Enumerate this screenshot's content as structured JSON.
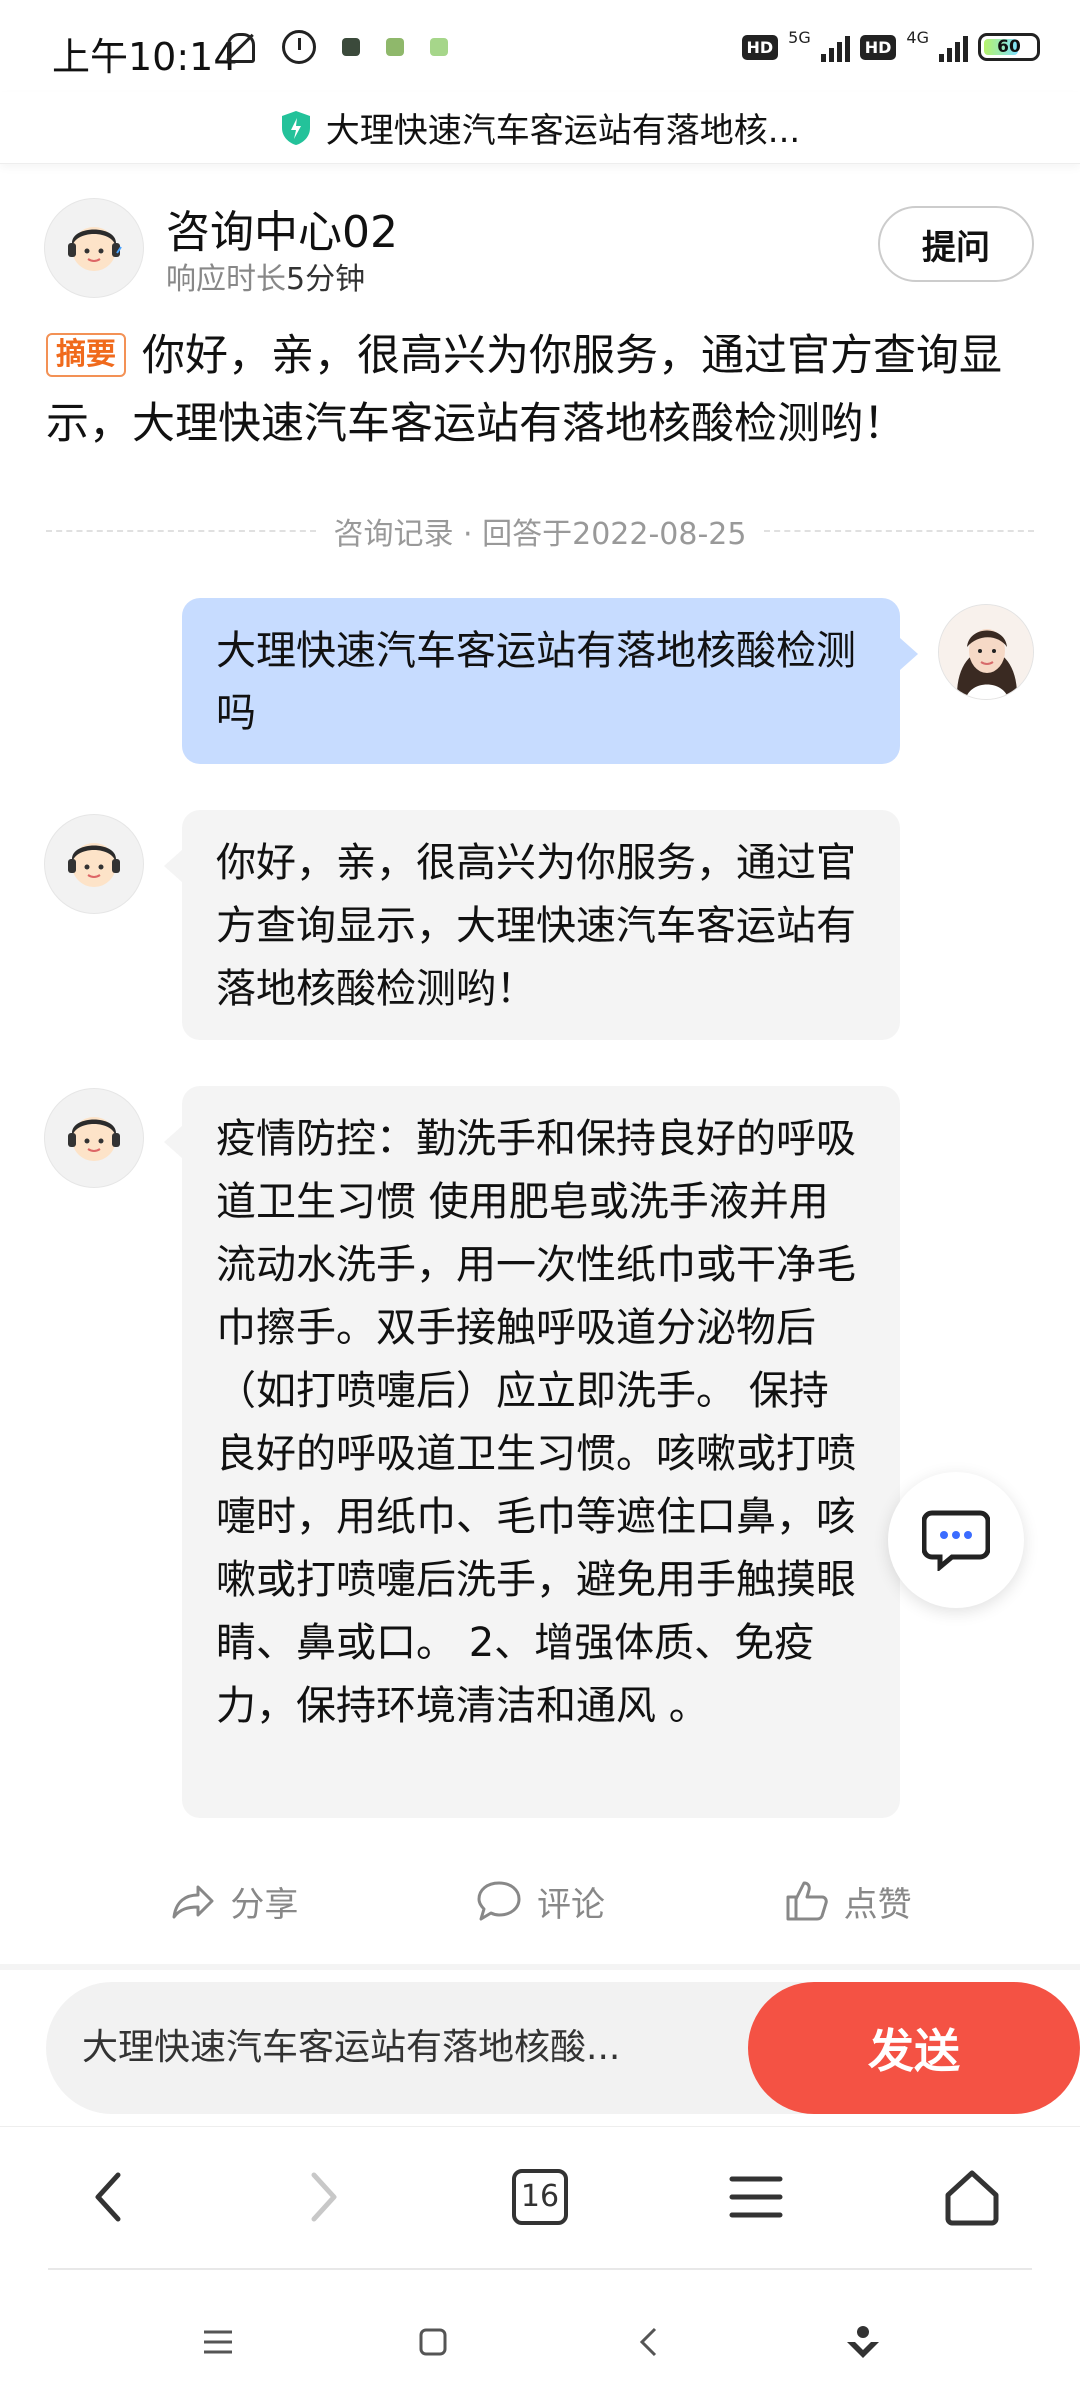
{
  "status_bar": {
    "time": "上午10:14",
    "hd1": "HD",
    "net1": "5G",
    "hd2": "HD",
    "net2": "4G",
    "battery": "60"
  },
  "url_bar": {
    "title": "大理快速汽车客运站有落地核..."
  },
  "agent": {
    "name": "咨询中心02",
    "response_prefix": "响应时长",
    "response_value": "5分钟",
    "ask_label": "提问"
  },
  "summary": {
    "badge": "摘要",
    "text": "你好，亲，很高兴为你服务，通过官方查询显示，大理快速汽车客运站有落地核酸检测哟！"
  },
  "divider": {
    "text": "咨询记录 · 回答于2022-08-25"
  },
  "messages": [
    {
      "from": "user",
      "text": "大理快速汽车客运站有落地核酸检测吗"
    },
    {
      "from": "bot",
      "text": "你好，亲，很高兴为你服务，通过官方查询显示，大理快速汽车客运站有落地核酸检测哟！"
    },
    {
      "from": "bot",
      "text": "疫情防控：勤洗手和保持良好的呼吸道卫生习惯 使用肥皂或洗手液并用流动水洗手，用一次性纸巾或干净毛巾擦手。双手接触呼吸道分泌物后（如打喷嚏后）应立即洗手。 保持良好的呼吸道卫生习惯。咳嗽或打喷嚏时，用纸巾、毛巾等遮住口鼻，咳嗽或打喷嚏后洗手，避免用手触摸眼睛、鼻或口。 2、增强体质、免疫力，保持环境清洁和通风 。"
    }
  ],
  "actions": {
    "share": "分享",
    "comment": "评论",
    "like": "点赞"
  },
  "input": {
    "value": "大理快速汽车客运站有落地核酸...",
    "send": "发送"
  },
  "browser_nav": {
    "tab_count": "16"
  },
  "colors": {
    "accent": "#f45244",
    "user_bubble": "#c7dcff",
    "bot_bubble": "#f4f4f4",
    "badge": "#f06a1c"
  }
}
